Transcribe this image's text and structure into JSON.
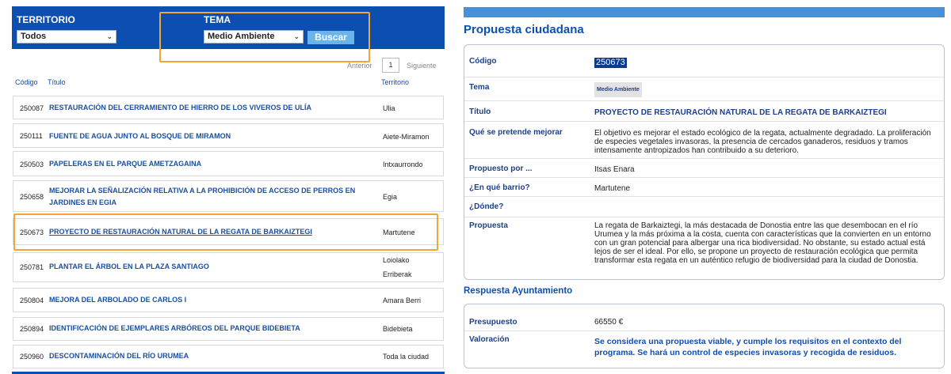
{
  "filters": {
    "territorio_label": "TERRITORIO",
    "territorio_value": "Todos",
    "tema_label": "TEMA",
    "tema_value": "Medio Ambiente",
    "search_label": "Buscar"
  },
  "pager": {
    "prev": "Anterior",
    "page": "1",
    "next": "Siguiente"
  },
  "columns": {
    "code": "Código",
    "title": "Título",
    "territory": "Territorio"
  },
  "rows": [
    {
      "code": "250087",
      "title": "RESTAURACIÓN DEL CERRAMIENTO DE HIERRO DE LOS VIVEROS DE ULÍA",
      "territory": "Ulia"
    },
    {
      "code": "250111",
      "title": "FUENTE DE AGUA JUNTO AL BOSQUE DE MIRAMON",
      "territory": "Aiete-Miramon"
    },
    {
      "code": "250503",
      "title": "PAPELERAS EN EL PARQUE AMETZAGAINA",
      "territory": "Intxaurrondo"
    },
    {
      "code": "250658",
      "title": "MEJORAR LA SEÑALIZACIÓN RELATIVA A LA PROHIBICIÓN DE ACCESO DE PERROS EN JARDINES EN EGIA",
      "territory": "Egia"
    },
    {
      "code": "250673",
      "title": "PROYECTO DE RESTAURACIÓN NATURAL DE LA REGATA DE BARKAIZTEGI",
      "territory": "Martutene"
    },
    {
      "code": "250781",
      "title": "PLANTAR EL ÁRBOL EN LA PLAZA SANTIAGO",
      "territory": "Loiolako Erriberak"
    },
    {
      "code": "250804",
      "title": "MEJORA DEL ARBOLADO DE CARLOS I",
      "territory": "Amara Berri"
    },
    {
      "code": "250894",
      "title": "IDENTIFICACIÓN DE EJEMPLARES ARBÓREOS DEL PARQUE BIDEBIETA",
      "territory": "Bidebieta"
    },
    {
      "code": "250960",
      "title": "DESCONTAMINACIÓN DEL RÍO URUMEA",
      "territory": "Toda la ciudad"
    }
  ],
  "detail": {
    "heading": "Propuesta ciudadana",
    "codigo_label": "Código",
    "codigo_value": "250673",
    "tema_label": "Tema",
    "tema_value": "Medio Ambiente",
    "titulo_label": "Título",
    "titulo_value": "PROYECTO DE RESTAURACIÓN NATURAL DE LA REGATA DE BARKAIZTEGI",
    "mejorar_label": "Qué se pretende mejorar",
    "mejorar_value": "El objetivo es mejorar el estado ecológico de la regata, actualmente degradado. La proliferación de especies vegetales invasoras, la presencia de cercados ganaderos, residuos y tramos intensamente antropizados han contribuido a su deterioro.",
    "propuesto_label": "Propuesto por ...",
    "propuesto_value": "Itsas Enara",
    "barrio_label": "¿En qué barrio?",
    "barrio_value": "Martutene",
    "donde_label": "¿Dónde?",
    "donde_value": "",
    "propuesta_label": "Propuesta",
    "propuesta_value": "La regata de Barkaiztegi, la más destacada de Donostia entre las que desembocan en el río Urumea y la más próxima a la costa, cuenta con características que la convierten en un entorno con un gran potencial para albergar una rica biodiversidad. No obstante, su estado actual está lejos de ser el ideal. Por ello, se propone un proyecto de restauración ecológica que permita transformar esta regata en un auténtico refugio de biodiversidad para la ciudad de Donostia."
  },
  "response": {
    "heading": "Respuesta Ayuntamiento",
    "presupuesto_label": "Presupuesto",
    "presupuesto_value": "66550 €",
    "valoracion_label": "Valoración",
    "valoracion_value": "Se considera una propuesta viable, y cumple los requisitos en el contexto del programa. Se hará un control de especies invasoras y recogida de residuos."
  },
  "colors": {
    "primary": "#0d4fb0",
    "highlight": "#f4a538",
    "button": "#6ab4ec"
  }
}
